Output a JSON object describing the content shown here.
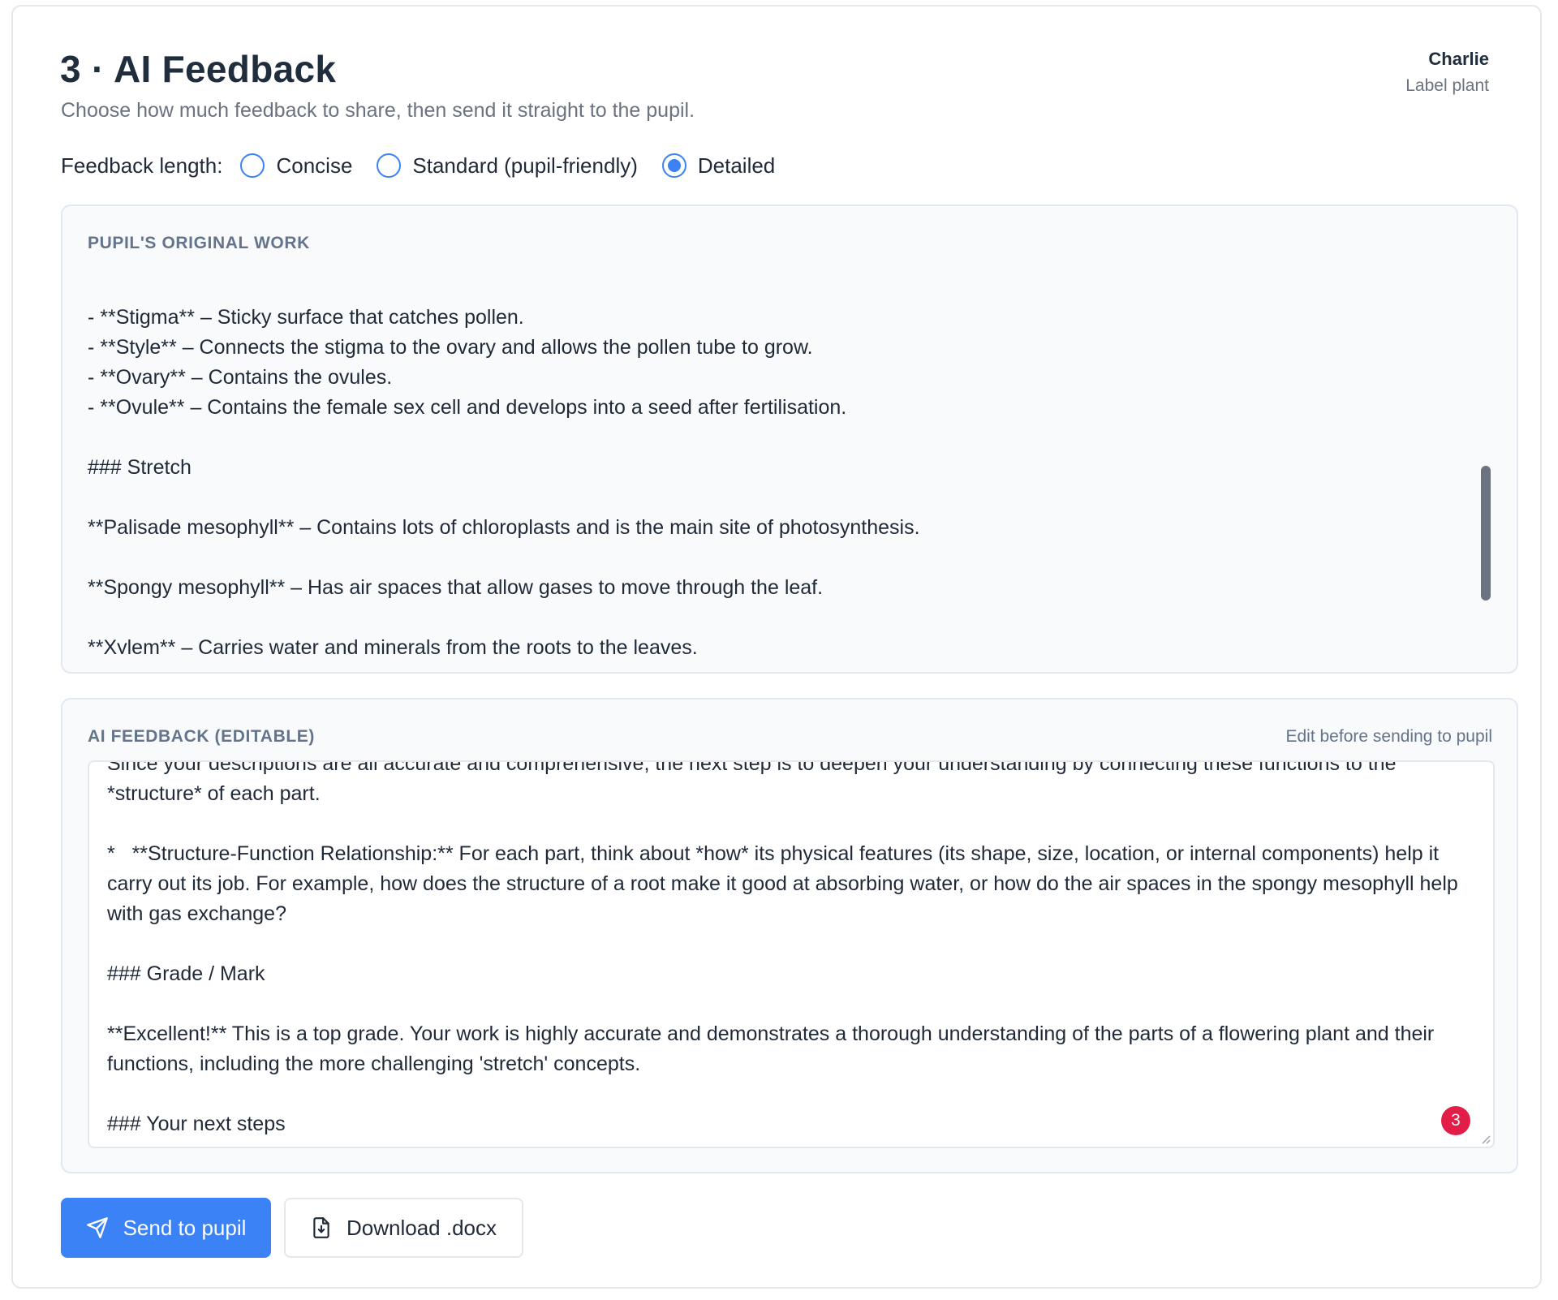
{
  "header": {
    "title": "3 · AI Feedback",
    "subtitle": "Choose how much feedback to share, then send it straight to the pupil."
  },
  "user": {
    "name": "Charlie",
    "task": "Label plant"
  },
  "feedback_length": {
    "label": "Feedback length:",
    "options": [
      {
        "label": "Concise",
        "checked": false
      },
      {
        "label": "Standard (pupil-friendly)",
        "checked": false
      },
      {
        "label": "Detailed",
        "checked": true
      }
    ],
    "accent_color": "#3b82f6"
  },
  "original_work": {
    "heading": "PUPIL'S ORIGINAL WORK",
    "text": "\n- **Stigma** – Sticky surface that catches pollen.\n- **Style** – Connects the stigma to the ovary and allows the pollen tube to grow.\n- **Ovary** – Contains the ovules.\n- **Ovule** – Contains the female sex cell and develops into a seed after fertilisation.\n\n### Stretch\n\n**Palisade mesophyll** – Contains lots of chloroplasts and is the main site of photosynthesis.\n\n**Spongy mesophyll** – Has air spaces that allow gases to move through the leaf.\n\n**Xylem** – Carries water and minerals from the roots to the leaves."
  },
  "ai_feedback": {
    "heading": "AI FEEDBACK (EDITABLE)",
    "hint": "Edit before sending to pupil",
    "text": "Since your descriptions are all accurate and comprehensive, the next step is to deepen your understanding by connecting these functions to the *structure* of each part.\n\n*   **Structure-Function Relationship:** For each part, think about *how* its physical features (its shape, size, location, or internal components) help it carry out its job. For example, how does the structure of a root make it good at absorbing water, or how do the air spaces in the spongy mesophyll help with gas exchange?\n\n### Grade / Mark\n\n**Excellent!** This is a top grade. Your work is highly accurate and demonstrates a thorough understanding of the parts of a flowering plant and their functions, including the more challenging 'stretch' concepts.\n\n### Your next steps",
    "badge_count": "3"
  },
  "actions": {
    "send_label": "Send to pupil",
    "send_icon": "send-icon",
    "download_label": "Download .docx",
    "download_icon": "file-download-icon"
  }
}
